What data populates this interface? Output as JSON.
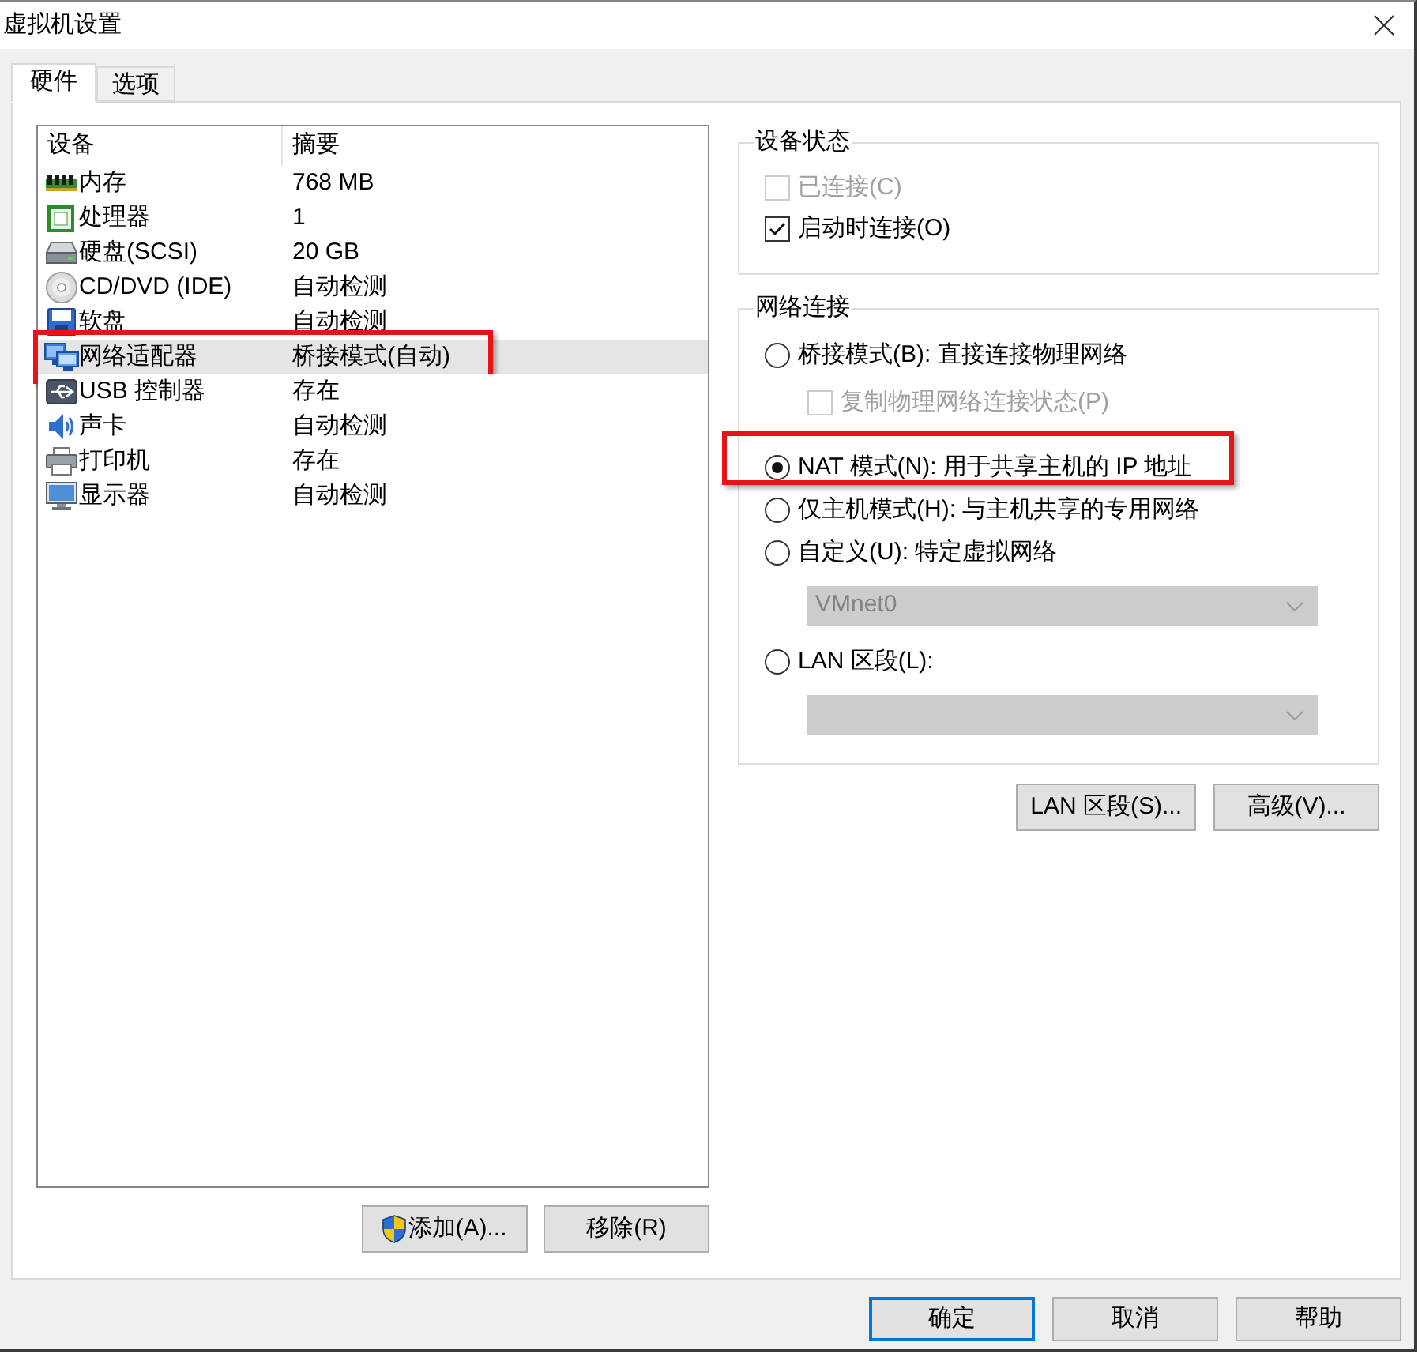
{
  "window": {
    "title": "虚拟机设置"
  },
  "tabs": [
    {
      "label": "硬件",
      "selected": true
    },
    {
      "label": "选项",
      "selected": false
    }
  ],
  "device_list": {
    "columns": [
      "设备",
      "摘要"
    ],
    "rows": [
      {
        "kind": "memory",
        "device": "内存",
        "summary": "768 MB",
        "selected": false,
        "highlighted": false
      },
      {
        "kind": "processor",
        "device": "处理器",
        "summary": "1",
        "selected": false,
        "highlighted": false
      },
      {
        "kind": "hard_disk",
        "device": "硬盘(SCSI)",
        "summary": "20 GB",
        "selected": false,
        "highlighted": false
      },
      {
        "kind": "cd_dvd",
        "device": "CD/DVD (IDE)",
        "summary": "自动检测",
        "selected": false,
        "highlighted": false
      },
      {
        "kind": "floppy",
        "device": "软盘",
        "summary": "自动检测",
        "selected": false,
        "highlighted": false
      },
      {
        "kind": "network_adapter",
        "device": "网络适配器",
        "summary": "桥接模式(自动)",
        "selected": true,
        "highlighted": true
      },
      {
        "kind": "usb",
        "device": "USB 控制器",
        "summary": "存在",
        "selected": false,
        "highlighted": false
      },
      {
        "kind": "sound",
        "device": "声卡",
        "summary": "自动检测",
        "selected": false,
        "highlighted": false
      },
      {
        "kind": "printer",
        "device": "打印机",
        "summary": "存在",
        "selected": false,
        "highlighted": false
      },
      {
        "kind": "display",
        "device": "显示器",
        "summary": "自动检测",
        "selected": false,
        "highlighted": false
      }
    ]
  },
  "list_buttons": [
    {
      "label": "添加(A)...",
      "elevated": true
    },
    {
      "label": "移除(R)",
      "elevated": false
    }
  ],
  "device_status": {
    "title": "设备状态",
    "options": [
      {
        "label": "已连接(C)",
        "checked": false,
        "disabled": true
      },
      {
        "label": "启动时连接(O)",
        "checked": true,
        "disabled": false
      }
    ]
  },
  "network_connection": {
    "title": "网络连接",
    "items": [
      {
        "kind": "radio",
        "label": "桥接模式(B): 直接连接物理网络",
        "selected": false,
        "highlighted": false
      },
      {
        "kind": "checkbox",
        "label": "复制物理网络连接状态(P)",
        "checked": false,
        "disabled": true
      },
      {
        "kind": "radio",
        "label": "NAT 模式(N): 用于共享主机的 IP 地址",
        "selected": true,
        "highlighted": true
      },
      {
        "kind": "radio",
        "label": "仅主机模式(H): 与主机共享的专用网络",
        "selected": false,
        "highlighted": false
      },
      {
        "kind": "radio",
        "label": "自定义(U): 特定虚拟网络",
        "selected": false,
        "highlighted": false
      },
      {
        "kind": "select",
        "value": "VMnet0",
        "disabled": true
      },
      {
        "kind": "radio",
        "label": "LAN 区段(L):",
        "selected": false,
        "highlighted": false
      },
      {
        "kind": "select",
        "disabled": true
      }
    ]
  },
  "network_buttons": [
    "LAN 区段(S)...",
    "高级(V)..."
  ],
  "dialog_buttons": [
    {
      "label": "确定",
      "default": true
    },
    {
      "label": "取消",
      "default": false
    },
    {
      "label": "帮助",
      "default": false
    }
  ]
}
